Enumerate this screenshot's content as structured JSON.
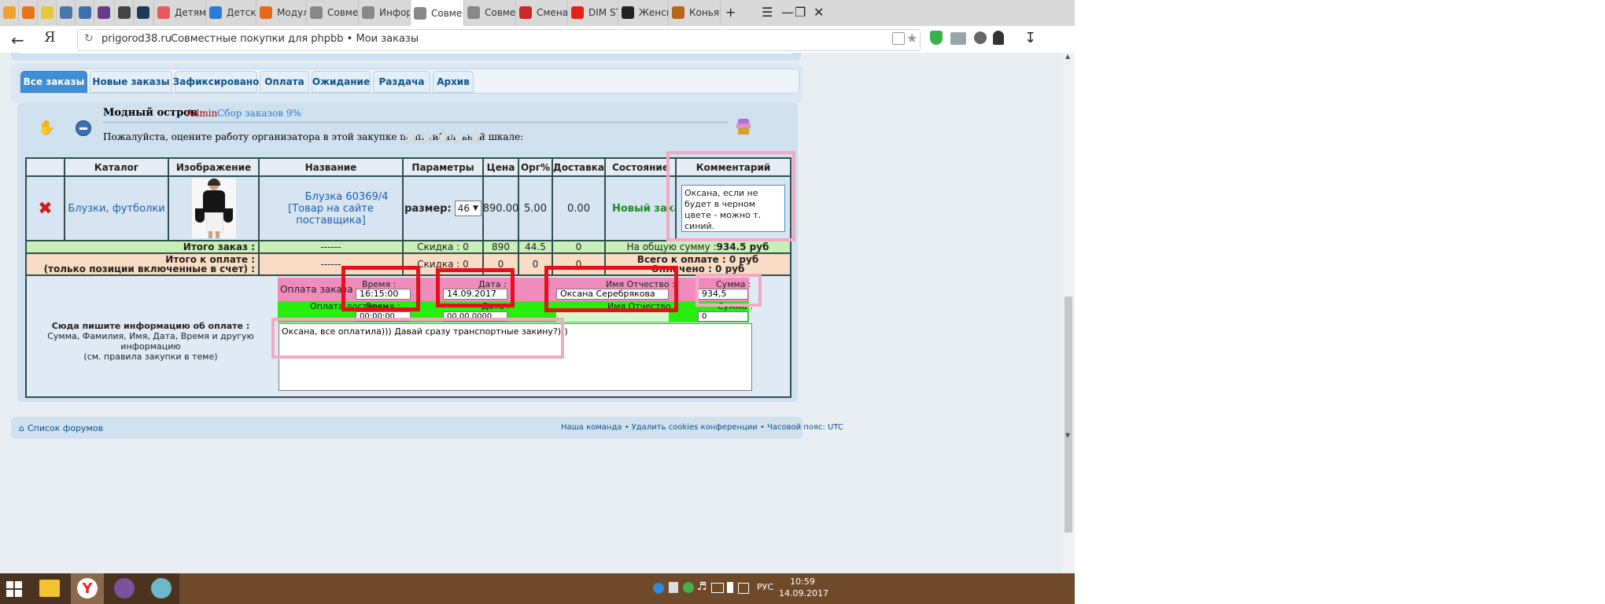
{
  "browser": {
    "tabs": [
      {
        "label": "",
        "color": "#f0a22e"
      },
      {
        "label": "",
        "color": "#e8751a"
      },
      {
        "label": "",
        "color": "#e6c83a"
      },
      {
        "label": "",
        "color": "#4a76a8"
      },
      {
        "label": "",
        "color": "#3d6fb4"
      },
      {
        "label": "",
        "color": "#6a3c8c"
      },
      {
        "label": "",
        "color": "#444444"
      },
      {
        "label": "",
        "color": "#1b3a5c"
      },
      {
        "label": "Детям - ",
        "color": "#e35b5b"
      },
      {
        "label": "Детская",
        "color": "#2a7fd4"
      },
      {
        "label": "Модуль",
        "color": "#e46b1d"
      },
      {
        "label": "Совмест",
        "color": "#888888"
      },
      {
        "label": "Информ",
        "color": "#888888"
      },
      {
        "label": "Совме",
        "color": "#888888"
      },
      {
        "label": "Совмест",
        "color": "#888888"
      },
      {
        "label": "Смена п",
        "color": "#c8282a"
      },
      {
        "label": "DIM STU",
        "color": "#e62117"
      },
      {
        "label": "Женская",
        "color": "#222222"
      },
      {
        "label": "Коньячн",
        "color": "#b5651d"
      }
    ],
    "new_tab": "+",
    "domain": "prigorod38.ru",
    "page_title": "Совместные покупки для phpbb • Мои заказы"
  },
  "nav_tabs": [
    "Все заказы",
    "Новые заказы",
    "Зафиксировано",
    "Оплата",
    "Ожидание",
    "Раздача",
    "Архив"
  ],
  "shop": {
    "name": "Модный остров",
    "admin": "Admin",
    "collection": "Сбор заказов 9%",
    "rating_prompt": "Пожалуйста, оцените работу организатора в этой закупке по пятибалльной шкале:",
    "stars": 5
  },
  "table": {
    "headers": [
      "Каталог",
      "Изображение",
      "Название",
      "Параметры",
      "Цена",
      "Орг%",
      "Доставка",
      "Состояние",
      "Комментарий"
    ],
    "row": {
      "catalog": "Блузки, футболки",
      "name_line1": "Блузка 60369/4",
      "name_line2": "[Товар на сайте поставщика]",
      "param_label": "размер:",
      "param_value": "46",
      "price": "890.00",
      "org": "5.00",
      "delivery": "0.00",
      "status": "Новый заказ",
      "comment": "Оксана, если не будет в черном цвете - можно т. синий."
    },
    "total": {
      "label": "Итого заказ :",
      "dashes": "------",
      "discount": "Скидка : 0",
      "price": "890",
      "org": "44.5",
      "delivery": "0",
      "sum_prefix": "На общую сумму : ",
      "sum_value": "934.5 руб"
    },
    "to_pay": {
      "label_line1": "Итого к оплате :",
      "label_line2": "(только позиции включенные в счет) :",
      "dashes": "------",
      "discount": "Скидка : 0",
      "price": "0",
      "org": "0",
      "delivery": "0",
      "total_line1": "Всего к оплате : 0 руб",
      "total_line2": "Оплачено : 0 руб"
    }
  },
  "payment": {
    "info_title": "Сюда пишите информацию об оплате :",
    "info_line1": "Сумма, Фамилия, Имя, Дата, Время и другую информацию",
    "info_line2": "(см. правила закупки в теме)",
    "row1_label": "Оплата заказа",
    "row2_label": "Оплата доставки",
    "time_label": "Время :",
    "date_label": "Дата :",
    "name_label": "Имя Отчество :",
    "sum_label": "Сумма :",
    "time_value": "16:15:00",
    "date_value": "14.09.2017",
    "name_value": "Оксана Серебрякова",
    "sum_value": "934,5",
    "time_value2": "00:00:00",
    "date_value2": "00.00.0000",
    "sum_value2": "0",
    "message": "Оксана, все оплатила))) Давай сразу транспортные закину?)))"
  },
  "footer": {
    "forum_list": "Список форумов",
    "links": "Наша команда • Удалить cookies конференции • Часовой пояс: UTC"
  },
  "taskbar": {
    "lang": "РУС",
    "time": "10:59",
    "date": "14.09.2017"
  }
}
